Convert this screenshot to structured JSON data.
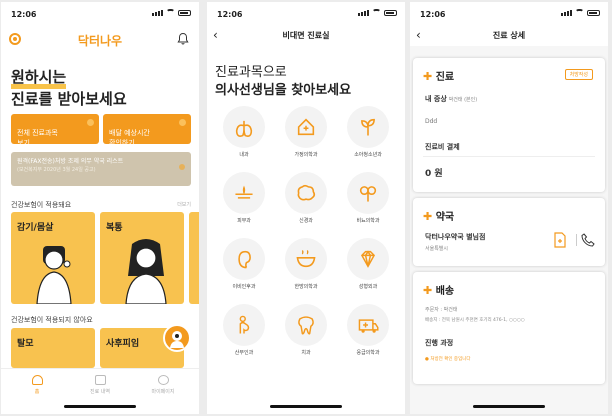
{
  "status": {
    "time": "12:06"
  },
  "home": {
    "brand": "닥터나우",
    "hero_line1": "원하시는",
    "hero_line2": "진료를 받아보세요",
    "btn_all": "전체 진료과목\n보기",
    "btn_delivery": "배달 예상시간\n확인하기",
    "notice_title": "원격(FAX전송)처방 조제 의무 약국 리스트",
    "notice_sub": "(보건복지부 2020년 3월 24일 공고)",
    "section1": "건강보험이 적용돼요",
    "section1_more": "더보기",
    "card1": "감기/몸살",
    "card2": "복통",
    "section2": "건강보험이 적용되지 않아요",
    "card3": "탈모",
    "card4": "사후피임",
    "tabs": [
      {
        "label": "홈"
      },
      {
        "label": "진료 내역"
      },
      {
        "label": "마이페이지"
      }
    ]
  },
  "remote": {
    "nav_title": "비대면 진료실",
    "hero_line1": "진료과목으로",
    "hero_line2": "의사선생님을 찾아보세요",
    "departments": [
      {
        "label": "내과",
        "icon": "lungs-icon"
      },
      {
        "label": "가정의학과",
        "icon": "house-icon"
      },
      {
        "label": "소아청소년과",
        "icon": "sprout-icon"
      },
      {
        "label": "피부과",
        "icon": "skin-icon"
      },
      {
        "label": "신경과",
        "icon": "brain-icon"
      },
      {
        "label": "비뇨의학과",
        "icon": "urology-icon"
      },
      {
        "label": "이비인후과",
        "icon": "ear-icon"
      },
      {
        "label": "한방의학과",
        "icon": "herbal-bowl-icon"
      },
      {
        "label": "성형외과",
        "icon": "diamond-icon"
      },
      {
        "label": "산부인과",
        "icon": "pregnancy-icon"
      },
      {
        "label": "치과",
        "icon": "tooth-icon"
      },
      {
        "label": "응급의학과",
        "icon": "ambulance-icon"
      }
    ]
  },
  "detail": {
    "nav_title": "진료 상세",
    "clinic_title": "진료",
    "clinic_badge": "처방작성",
    "symptom_label": "내 증상",
    "symptom_name": "박건태 (본인)",
    "symptom_text": "Ddd",
    "fee_label": "진료비 결제",
    "fee_value": "0 원",
    "pharmacy_title": "약국",
    "pharmacy_name": "닥터나우약국 별님점",
    "pharmacy_addr": "서울특별시",
    "delivery_title": "배송",
    "recipient": "주문자 : 박건태",
    "address": "배송지 : 전북 남원시 주천면 호기리 476-1, ○○○○",
    "progress_label": "진행 과정",
    "progress_item": "처방전 확인 중입니다"
  },
  "colors": {
    "accent": "#f39a1e",
    "card": "#f8c24f",
    "notice": "#cfc4ad"
  }
}
